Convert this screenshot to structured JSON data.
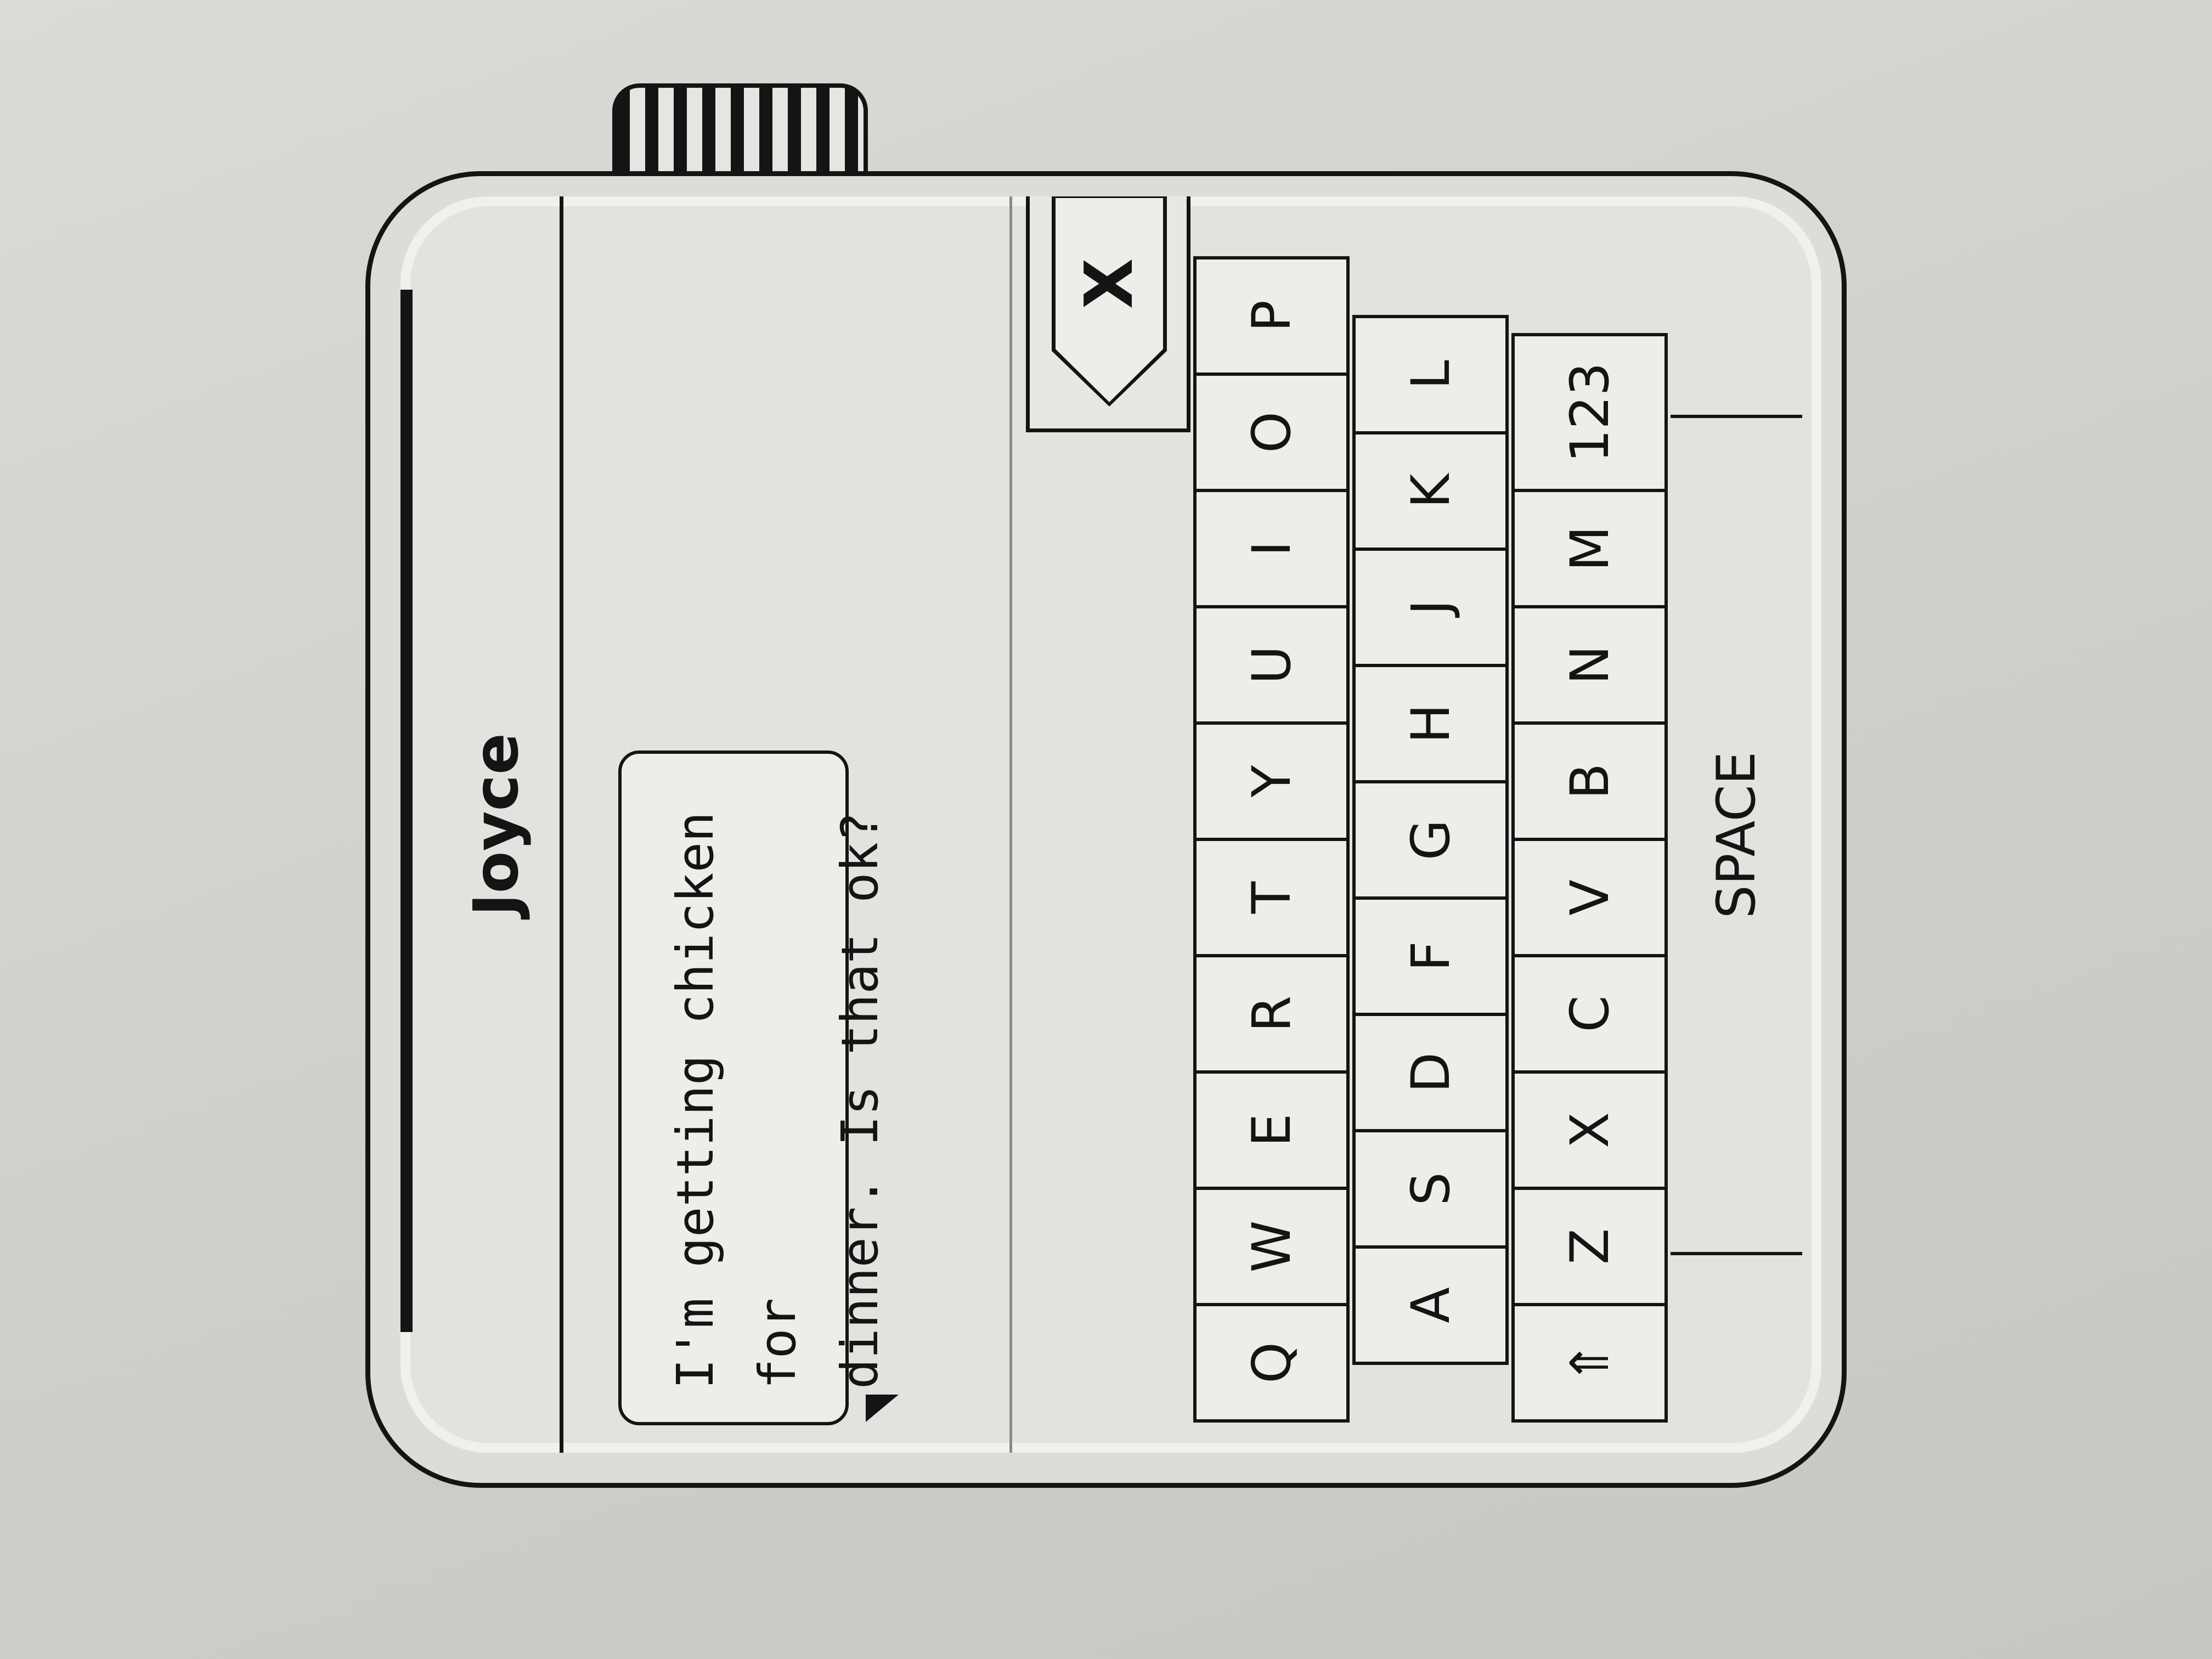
{
  "contact": {
    "name": "Joyce"
  },
  "message": {
    "line1": "I'm getting chicken for",
    "line2": "dinner. Is that ok?"
  },
  "keyboard": {
    "delete_label": "X",
    "row1": [
      "Q",
      "W",
      "E",
      "R",
      "T",
      "Y",
      "U",
      "I",
      "O",
      "P"
    ],
    "row2": [
      "A",
      "S",
      "D",
      "F",
      "G",
      "H",
      "J",
      "K",
      "L"
    ],
    "row3": [
      "⇑",
      "Z",
      "X",
      "C",
      "V",
      "B",
      "N",
      "M",
      "123"
    ],
    "space_label": "SPACE"
  }
}
